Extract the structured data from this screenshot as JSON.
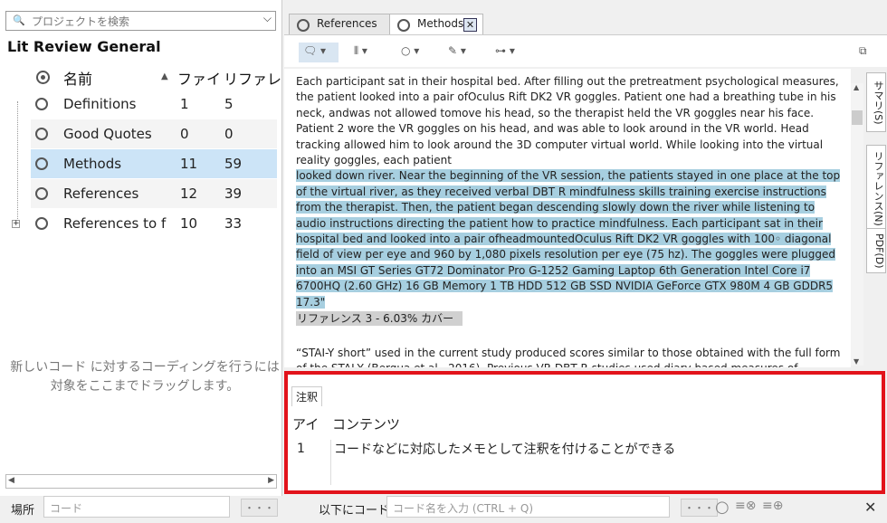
{
  "sidebar": {
    "search_placeholder": "プロジェクトを検索",
    "project_name": "Lit Review General",
    "columns": {
      "name": "名前",
      "files": "ファイ",
      "refs": "リファレ"
    },
    "codes": [
      {
        "name": "Definitions",
        "files": "1",
        "refs": "5"
      },
      {
        "name": "Good Quotes",
        "files": "0",
        "refs": "0"
      },
      {
        "name": "Methods",
        "files": "11",
        "refs": "59"
      },
      {
        "name": "References",
        "files": "12",
        "refs": "39"
      },
      {
        "name": "References to f",
        "files": "10",
        "refs": "33"
      }
    ],
    "hint_line1": "新しいコード に対するコーディングを行うには",
    "hint_line2": "対象をここまでドラッグします。"
  },
  "tabs": [
    {
      "label": "References"
    },
    {
      "label": "Methods"
    }
  ],
  "content": {
    "para1": "Each participant sat in their hospital bed. After filling out the pretreatment psychological measures, the patient looked into a pair ofOculus Rift DK2 VR goggles. Patient one had a breathing tube in his neck, andwas not allowed tomove his head, so the therapist held the VR goggles near his face. Patient 2 wore the VR goggles on his head, and was able to look around in the VR world. Head tracking allowed him to look around the 3D computer virtual world. While looking into the virtual reality goggles, each patient",
    "para1_hl": "looked down river. Near the beginning of the VR session, the patients stayed in one place at the top of the virtual river, as they received verbal DBT R mindfulness skills training exercise instructions from the therapist. Then, the patient began descending slowly down the river while listening to audio instructions directing the patient how to practice mindfulness. Each participant sat in their hospital bed and looked into a pair ofheadmountedOculus Rift DK2 VR goggles with 100◦ diagonal field of view per eye and 960 by 1,080 pixels resolution per eye (75 hz). The goggles were plugged into an MSI GT Series GT72 Dominator Pro G-1252 Gaming Laptop 6th Generation Intel Core i7 6700HQ (2.60 GHz) 16 GB Memory 1 TB HDD 512 GB SSD NVIDIA GeForce GTX 980M 4 GB GDDR5 17.3\"",
    "coverage": "リファレンス 3 - 6.03% カバー",
    "para2": "“STAI-Y short” used in the current study produced scores similar to those obtained with the full form of the STAI-Y (Bergua et al., 2016). Previous VR DBT R studies used diary based measures of"
  },
  "side_tabs": [
    "サマリ(S)",
    "リファレンス(N)",
    "PDF(D)"
  ],
  "annotations": {
    "tab": "注釈",
    "col_id": "アイ",
    "col_content": "コンテンツ",
    "rows": [
      {
        "id": "1",
        "text": "コードなどに対応したメモとして注釈を付けることができる"
      }
    ]
  },
  "bottom": {
    "location_label": "場所",
    "location_placeholder": "コード",
    "code_label": "以下にコード",
    "code_placeholder": "コード名を入力 (CTRL + Q)",
    "dots": "・・・"
  }
}
